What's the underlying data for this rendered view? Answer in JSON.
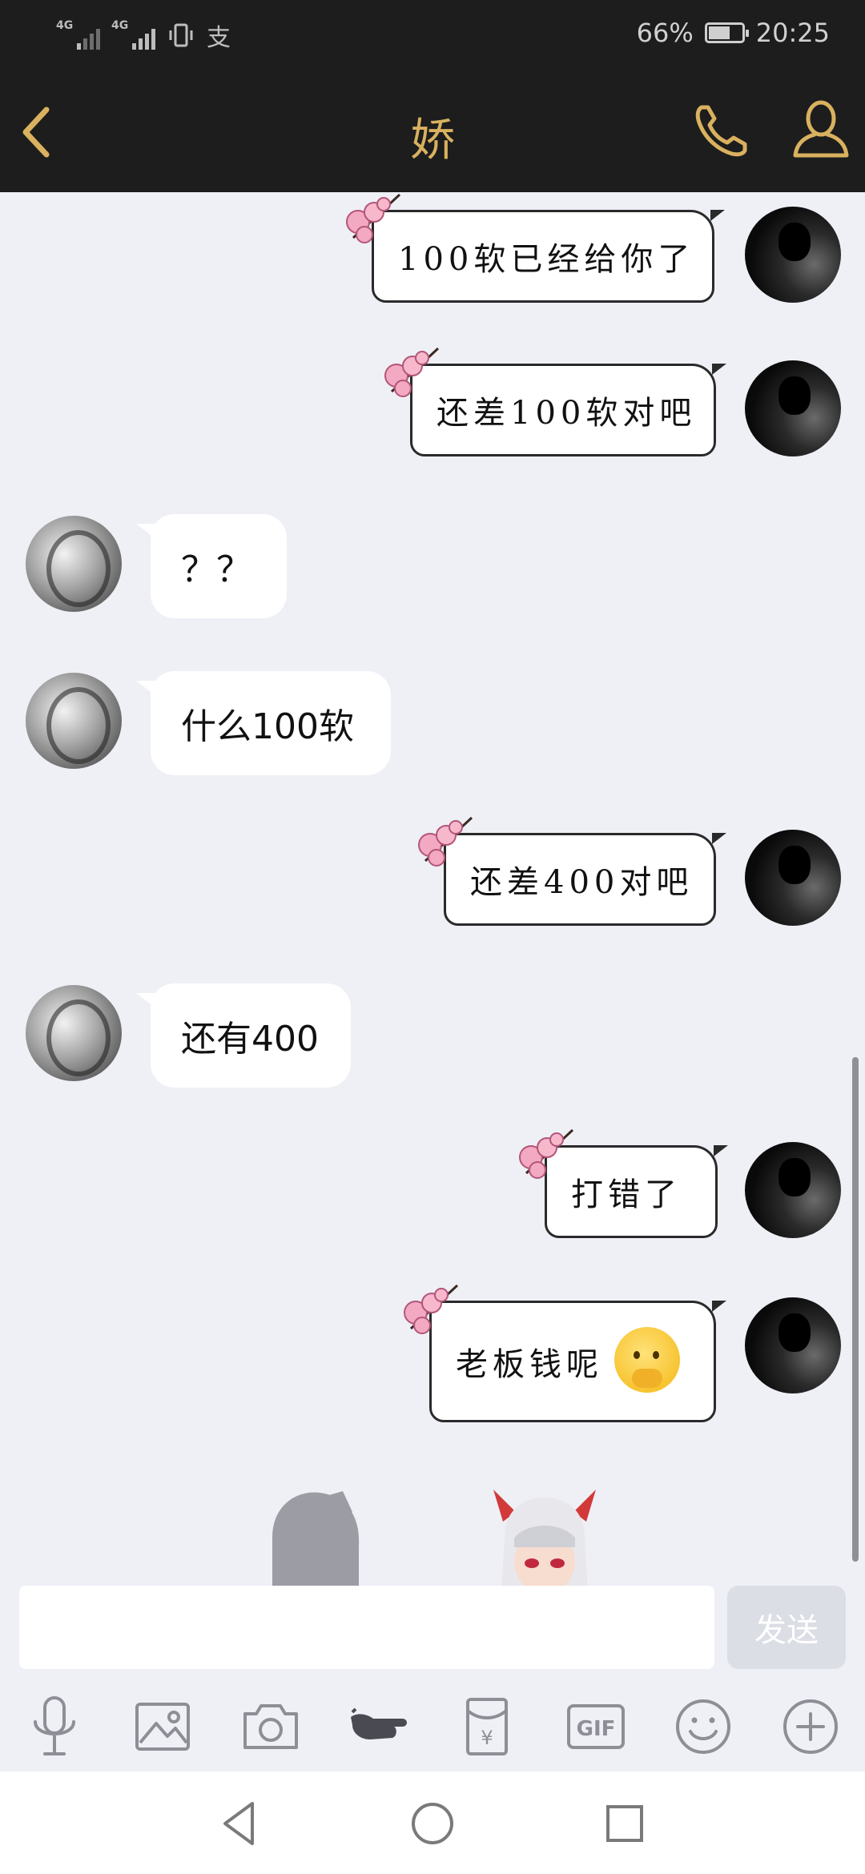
{
  "status_bar": {
    "signal1_label": "4G",
    "signal2_label": "4G",
    "extra_icon_label": "支",
    "battery_percent": "66%",
    "battery_level": 0.66,
    "time": "20:25"
  },
  "header": {
    "title": "娇",
    "accent_color": "#d9b15f"
  },
  "messages": [
    {
      "side": "out",
      "text": "100软已经给你了"
    },
    {
      "side": "out",
      "text": "还差100软对吧"
    },
    {
      "side": "in",
      "text": "？？"
    },
    {
      "side": "in",
      "text": "什么100软"
    },
    {
      "side": "out",
      "text": "还差400对吧"
    },
    {
      "side": "in",
      "text": "还有400"
    },
    {
      "side": "out",
      "text": "打错了"
    },
    {
      "side": "out",
      "text": "老板钱呢",
      "emoji": "thinking-face-icon"
    }
  ],
  "composer": {
    "value": "",
    "send_label": "发送"
  },
  "toolbar": {
    "items": [
      "microphone-icon",
      "image-icon",
      "camera-icon",
      "poke-hand-icon",
      "red-packet-icon",
      "gif-icon",
      "emoji-icon",
      "plus-icon"
    ],
    "gif_label": "GIF",
    "red_packet_label": "¥"
  },
  "nav": {
    "items": [
      "back-triangle-icon",
      "home-circle-icon",
      "recents-square-icon"
    ]
  }
}
